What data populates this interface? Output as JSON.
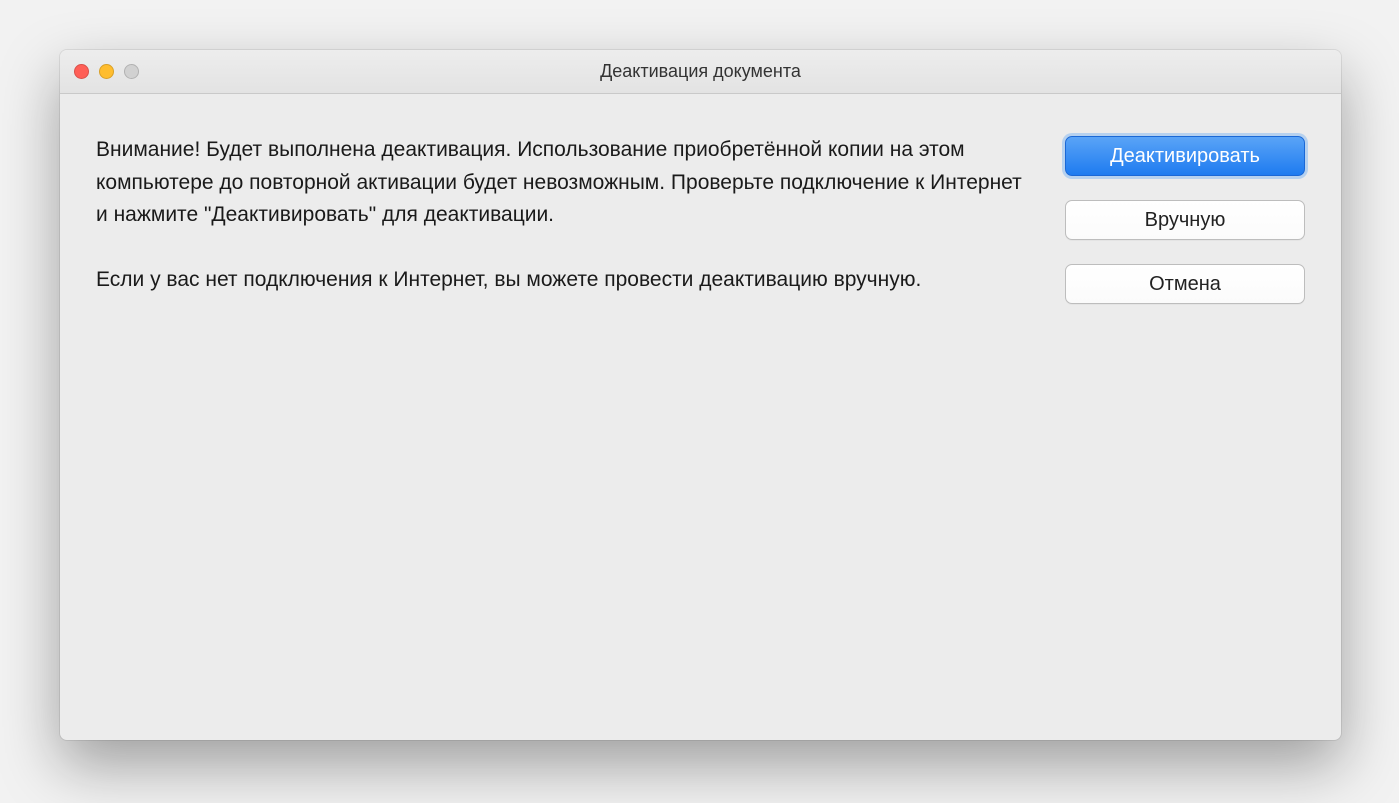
{
  "window": {
    "title": "Деактивация документа"
  },
  "message": {
    "text": "Внимание! Будет выполнена деактивация. Использование приобретённой копии на этом компьютере до повторной активации будет невозможным. Проверьте подключение к Интернет и нажмите \"Деактивировать\" для деактивации.\n\nЕсли у вас нет подключения к Интернет, вы можете провести деактивацию вручную."
  },
  "buttons": {
    "deactivate": "Деактивировать",
    "manual": "Вручную",
    "cancel": "Отмена"
  },
  "traffic_lights": {
    "close": "close-icon",
    "minimize": "minimize-icon",
    "zoom": "zoom-icon"
  },
  "colors": {
    "primary": "#2f86f3",
    "window_bg": "#ececec"
  }
}
